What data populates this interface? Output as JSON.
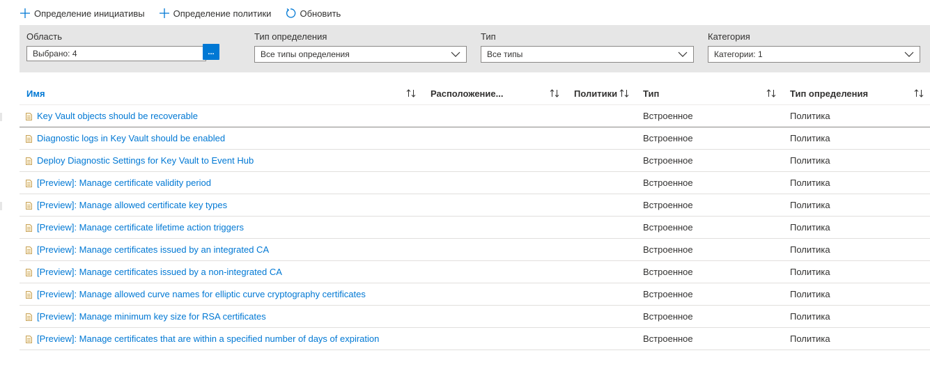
{
  "toolbar": {
    "items": [
      {
        "label": "Определение инициативы",
        "icon": "plus-icon"
      },
      {
        "label": "Определение политики",
        "icon": "plus-icon"
      },
      {
        "label": "Обновить",
        "icon": "refresh-icon"
      }
    ]
  },
  "filters": {
    "scope": {
      "label": "Область",
      "value": "Выбрано: 4",
      "button": "..."
    },
    "definition_type": {
      "label": "Тип определения",
      "value": "Все типы определения"
    },
    "type": {
      "label": "Тип",
      "value": "Все типы"
    },
    "category": {
      "label": "Категория",
      "value": "Категории: 1"
    }
  },
  "table": {
    "headers": {
      "name": "Имя",
      "location": "Расположение...",
      "policies": "Политики",
      "type": "Тип",
      "definition_type": "Тип определения"
    },
    "rows": [
      {
        "name": "Key Vault objects should be recoverable",
        "type": "Встроенное",
        "definition_type": "Политика"
      },
      {
        "name": "Diagnostic logs in Key Vault should be enabled",
        "type": "Встроенное",
        "definition_type": "Политика"
      },
      {
        "name": "Deploy Diagnostic Settings for Key Vault to Event Hub",
        "type": "Встроенное",
        "definition_type": "Политика"
      },
      {
        "name": "[Preview]: Manage certificate validity period",
        "type": "Встроенное",
        "definition_type": "Политика"
      },
      {
        "name": "[Preview]: Manage allowed certificate key types",
        "type": "Встроенное",
        "definition_type": "Политика"
      },
      {
        "name": "[Preview]: Manage certificate lifetime action triggers",
        "type": "Встроенное",
        "definition_type": "Политика"
      },
      {
        "name": "[Preview]: Manage certificates issued by an integrated CA",
        "type": "Встроенное",
        "definition_type": "Политика"
      },
      {
        "name": "[Preview]: Manage certificates issued by a non-integrated CA",
        "type": "Встроенное",
        "definition_type": "Политика"
      },
      {
        "name": "[Preview]: Manage allowed curve names for elliptic curve cryptography certificates",
        "type": "Встроенное",
        "definition_type": "Политика"
      },
      {
        "name": "[Preview]: Manage minimum key size for RSA certificates",
        "type": "Встроенное",
        "definition_type": "Политика"
      },
      {
        "name": "[Preview]: Manage certificates that are within a specified number of days of expiration",
        "type": "Встроенное",
        "definition_type": "Политика"
      }
    ]
  },
  "colors": {
    "accent": "#0078d4",
    "panel": "#e6e6e6",
    "doc_icon": "#c8a35a"
  }
}
